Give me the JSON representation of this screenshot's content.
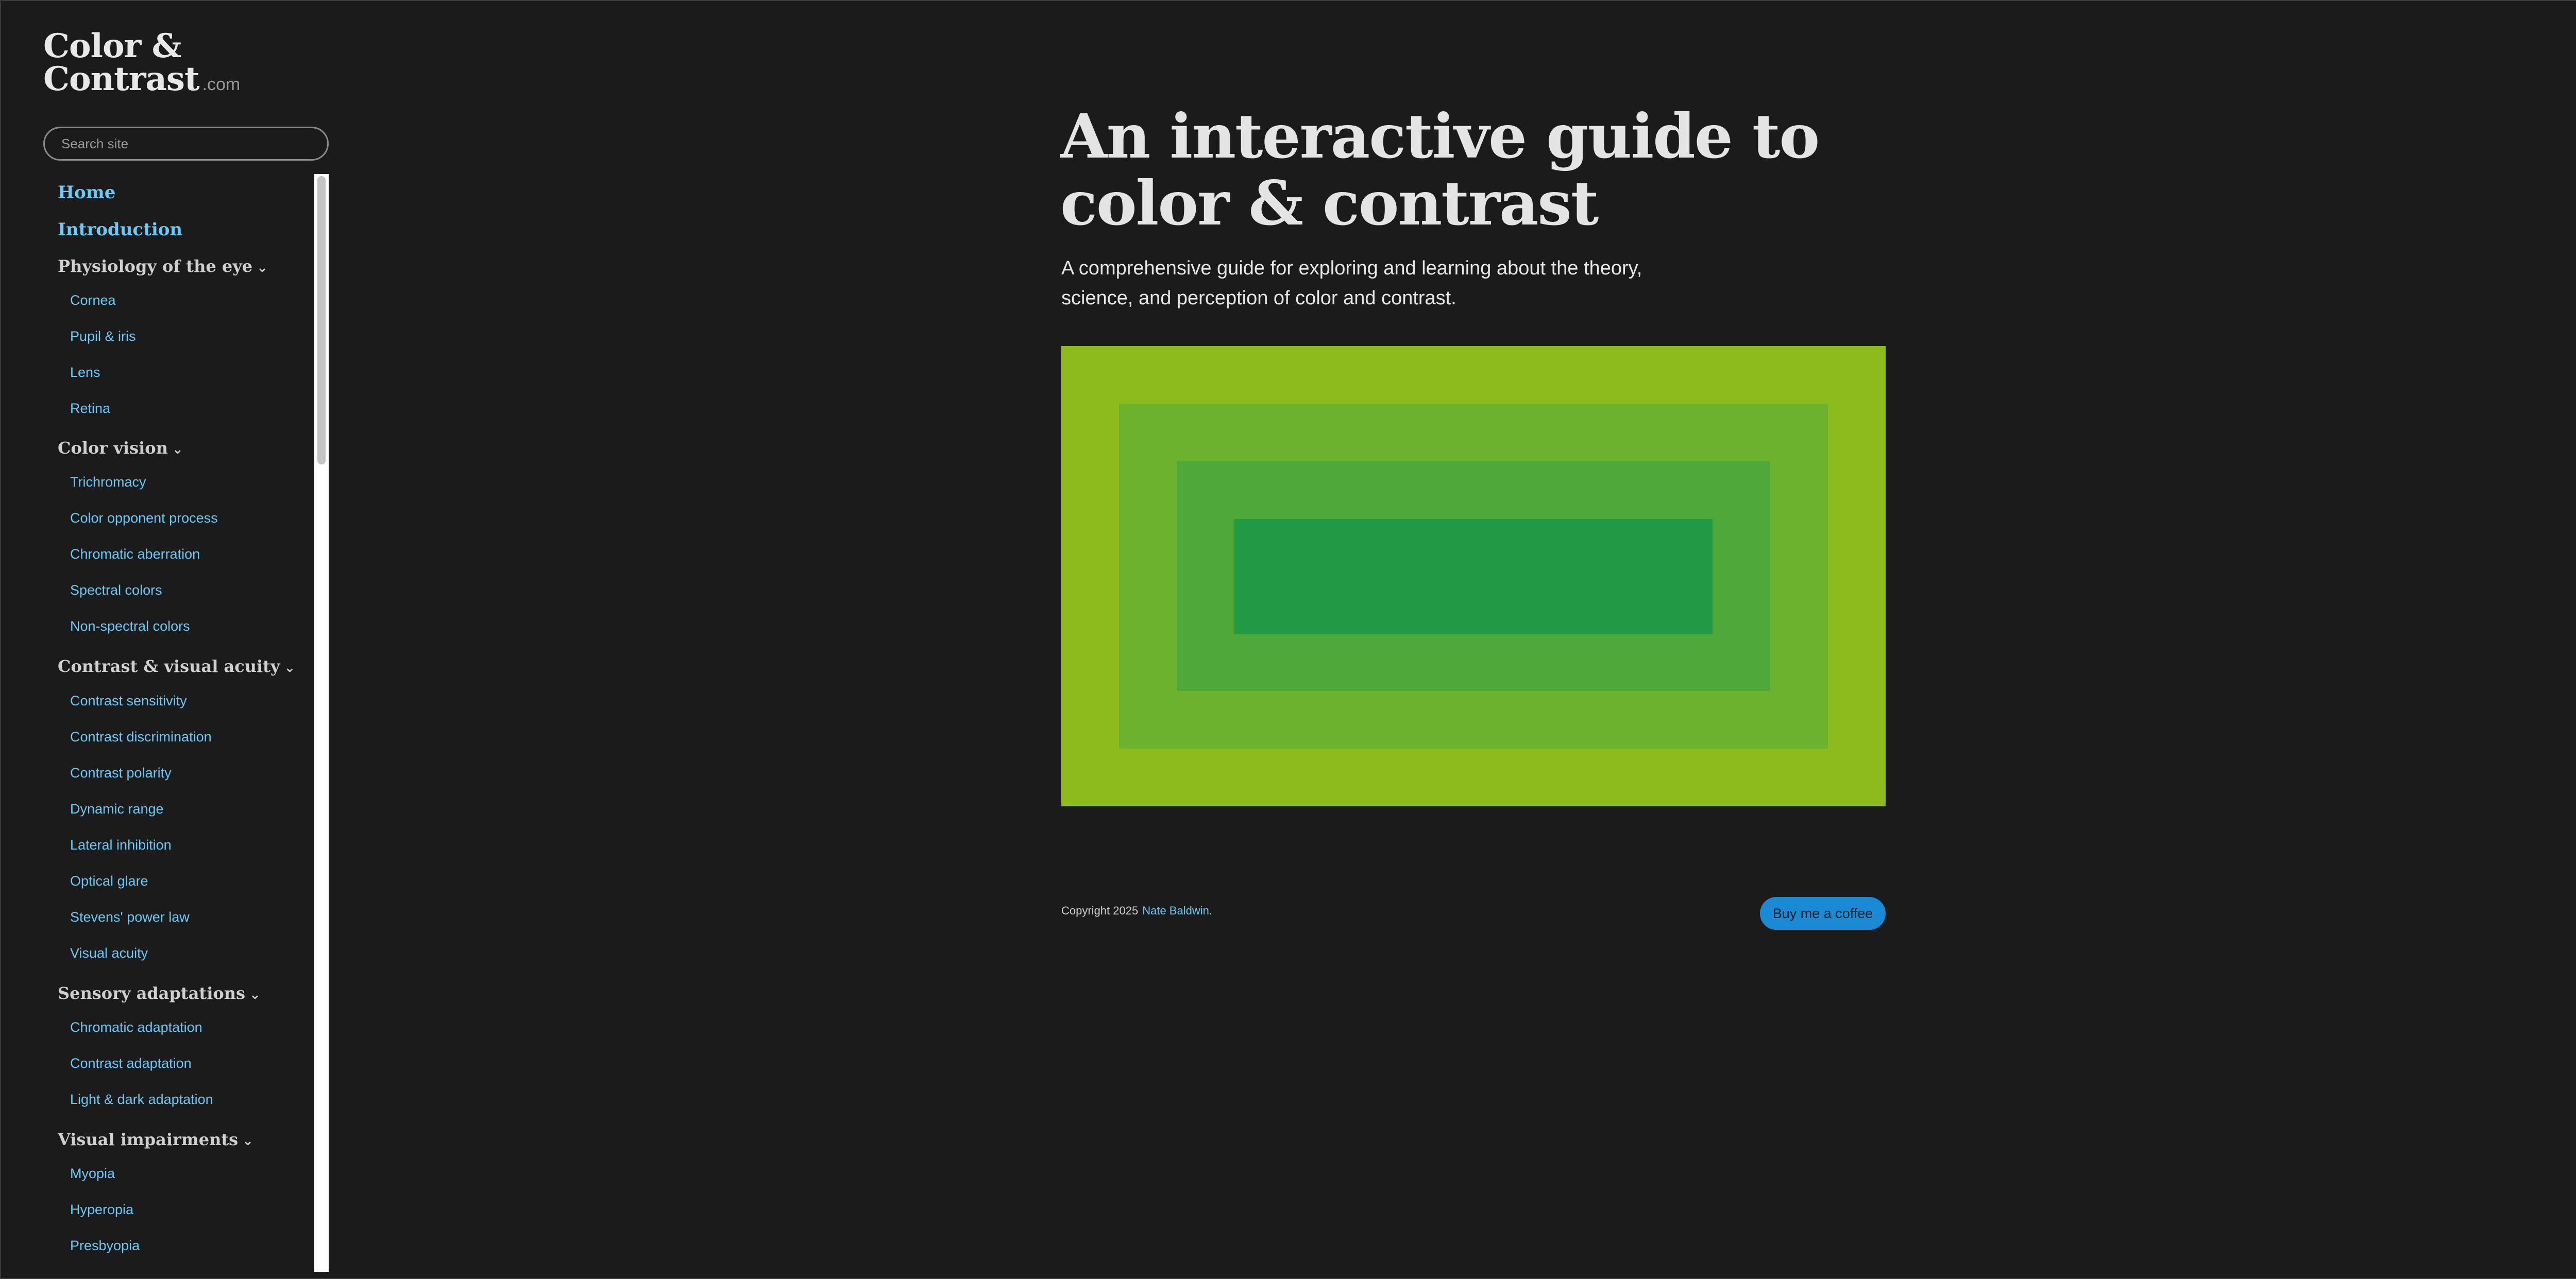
{
  "logo": {
    "line1": "Color &",
    "line2": "Contrast",
    "suffix": ".com"
  },
  "search": {
    "placeholder": "Search site"
  },
  "nav": {
    "items": [
      {
        "kind": "top",
        "label": "Home"
      },
      {
        "kind": "top",
        "label": "Introduction"
      },
      {
        "kind": "section",
        "label": "Physiology of the eye"
      },
      {
        "kind": "sub",
        "label": "Cornea"
      },
      {
        "kind": "sub",
        "label": "Pupil & iris"
      },
      {
        "kind": "sub",
        "label": "Lens"
      },
      {
        "kind": "sub",
        "label": "Retina"
      },
      {
        "kind": "section",
        "label": "Color vision"
      },
      {
        "kind": "sub",
        "label": "Trichromacy"
      },
      {
        "kind": "sub",
        "label": "Color opponent process"
      },
      {
        "kind": "sub",
        "label": "Chromatic aberration"
      },
      {
        "kind": "sub",
        "label": "Spectral colors"
      },
      {
        "kind": "sub",
        "label": "Non-spectral colors"
      },
      {
        "kind": "section",
        "label": "Contrast & visual acuity"
      },
      {
        "kind": "sub",
        "label": "Contrast sensitivity"
      },
      {
        "kind": "sub",
        "label": "Contrast discrimination"
      },
      {
        "kind": "sub",
        "label": "Contrast polarity"
      },
      {
        "kind": "sub",
        "label": "Dynamic range"
      },
      {
        "kind": "sub",
        "label": "Lateral inhibition"
      },
      {
        "kind": "sub",
        "label": "Optical glare"
      },
      {
        "kind": "sub",
        "label": "Stevens' power law"
      },
      {
        "kind": "sub",
        "label": "Visual acuity"
      },
      {
        "kind": "section",
        "label": "Sensory adaptations"
      },
      {
        "kind": "sub",
        "label": "Chromatic adaptation"
      },
      {
        "kind": "sub",
        "label": "Contrast adaptation"
      },
      {
        "kind": "sub",
        "label": "Light & dark adaptation"
      },
      {
        "kind": "section",
        "label": "Visual impairments"
      },
      {
        "kind": "sub",
        "label": "Myopia"
      },
      {
        "kind": "sub",
        "label": "Hyperopia"
      },
      {
        "kind": "sub",
        "label": "Presbyopia"
      }
    ],
    "chevron_icon": "chevron-down-icon"
  },
  "main": {
    "title_line1": "An interactive guide to",
    "title_line2": "color & contrast",
    "subtitle_line1": "A comprehensive guide for exploring and learning about the theory,",
    "subtitle_line2": "science, and perception of color and contrast.",
    "hero_colors": [
      "#8dba1d",
      "#6db22f",
      "#4ea83a",
      "#229a45"
    ]
  },
  "footer": {
    "copyright": "Copyright 2025",
    "author": "Nate Baldwin",
    "period": ".",
    "coffee_label": "Buy me a coffee"
  },
  "colors": {
    "background": "#1b1b1b",
    "link": "#6cc8f5",
    "button": "#1a8ad4"
  }
}
